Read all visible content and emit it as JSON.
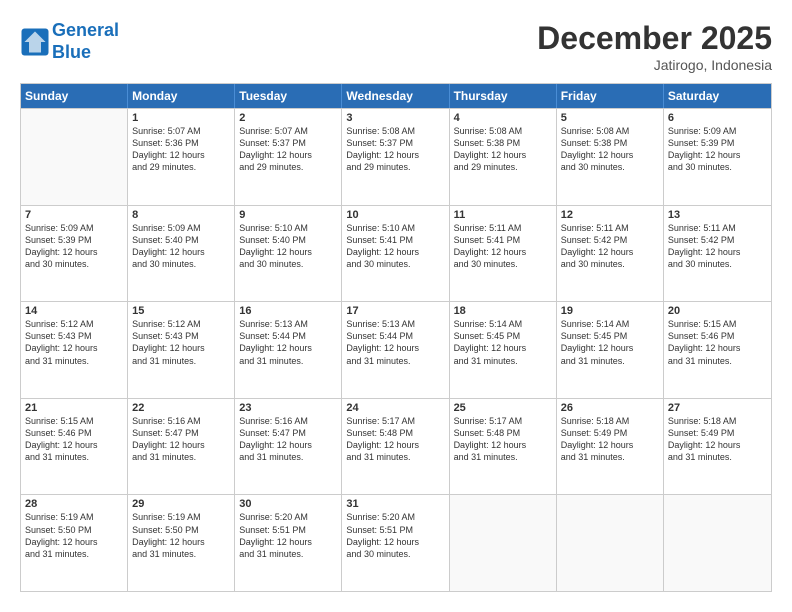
{
  "logo": {
    "line1": "General",
    "line2": "Blue"
  },
  "title": "December 2025",
  "subtitle": "Jatirogo, Indonesia",
  "header_days": [
    "Sunday",
    "Monday",
    "Tuesday",
    "Wednesday",
    "Thursday",
    "Friday",
    "Saturday"
  ],
  "weeks": [
    [
      {
        "day": "",
        "lines": []
      },
      {
        "day": "1",
        "lines": [
          "Sunrise: 5:07 AM",
          "Sunset: 5:36 PM",
          "Daylight: 12 hours",
          "and 29 minutes."
        ]
      },
      {
        "day": "2",
        "lines": [
          "Sunrise: 5:07 AM",
          "Sunset: 5:37 PM",
          "Daylight: 12 hours",
          "and 29 minutes."
        ]
      },
      {
        "day": "3",
        "lines": [
          "Sunrise: 5:08 AM",
          "Sunset: 5:37 PM",
          "Daylight: 12 hours",
          "and 29 minutes."
        ]
      },
      {
        "day": "4",
        "lines": [
          "Sunrise: 5:08 AM",
          "Sunset: 5:38 PM",
          "Daylight: 12 hours",
          "and 29 minutes."
        ]
      },
      {
        "day": "5",
        "lines": [
          "Sunrise: 5:08 AM",
          "Sunset: 5:38 PM",
          "Daylight: 12 hours",
          "and 30 minutes."
        ]
      },
      {
        "day": "6",
        "lines": [
          "Sunrise: 5:09 AM",
          "Sunset: 5:39 PM",
          "Daylight: 12 hours",
          "and 30 minutes."
        ]
      }
    ],
    [
      {
        "day": "7",
        "lines": [
          "Sunrise: 5:09 AM",
          "Sunset: 5:39 PM",
          "Daylight: 12 hours",
          "and 30 minutes."
        ]
      },
      {
        "day": "8",
        "lines": [
          "Sunrise: 5:09 AM",
          "Sunset: 5:40 PM",
          "Daylight: 12 hours",
          "and 30 minutes."
        ]
      },
      {
        "day": "9",
        "lines": [
          "Sunrise: 5:10 AM",
          "Sunset: 5:40 PM",
          "Daylight: 12 hours",
          "and 30 minutes."
        ]
      },
      {
        "day": "10",
        "lines": [
          "Sunrise: 5:10 AM",
          "Sunset: 5:41 PM",
          "Daylight: 12 hours",
          "and 30 minutes."
        ]
      },
      {
        "day": "11",
        "lines": [
          "Sunrise: 5:11 AM",
          "Sunset: 5:41 PM",
          "Daylight: 12 hours",
          "and 30 minutes."
        ]
      },
      {
        "day": "12",
        "lines": [
          "Sunrise: 5:11 AM",
          "Sunset: 5:42 PM",
          "Daylight: 12 hours",
          "and 30 minutes."
        ]
      },
      {
        "day": "13",
        "lines": [
          "Sunrise: 5:11 AM",
          "Sunset: 5:42 PM",
          "Daylight: 12 hours",
          "and 30 minutes."
        ]
      }
    ],
    [
      {
        "day": "14",
        "lines": [
          "Sunrise: 5:12 AM",
          "Sunset: 5:43 PM",
          "Daylight: 12 hours",
          "and 31 minutes."
        ]
      },
      {
        "day": "15",
        "lines": [
          "Sunrise: 5:12 AM",
          "Sunset: 5:43 PM",
          "Daylight: 12 hours",
          "and 31 minutes."
        ]
      },
      {
        "day": "16",
        "lines": [
          "Sunrise: 5:13 AM",
          "Sunset: 5:44 PM",
          "Daylight: 12 hours",
          "and 31 minutes."
        ]
      },
      {
        "day": "17",
        "lines": [
          "Sunrise: 5:13 AM",
          "Sunset: 5:44 PM",
          "Daylight: 12 hours",
          "and 31 minutes."
        ]
      },
      {
        "day": "18",
        "lines": [
          "Sunrise: 5:14 AM",
          "Sunset: 5:45 PM",
          "Daylight: 12 hours",
          "and 31 minutes."
        ]
      },
      {
        "day": "19",
        "lines": [
          "Sunrise: 5:14 AM",
          "Sunset: 5:45 PM",
          "Daylight: 12 hours",
          "and 31 minutes."
        ]
      },
      {
        "day": "20",
        "lines": [
          "Sunrise: 5:15 AM",
          "Sunset: 5:46 PM",
          "Daylight: 12 hours",
          "and 31 minutes."
        ]
      }
    ],
    [
      {
        "day": "21",
        "lines": [
          "Sunrise: 5:15 AM",
          "Sunset: 5:46 PM",
          "Daylight: 12 hours",
          "and 31 minutes."
        ]
      },
      {
        "day": "22",
        "lines": [
          "Sunrise: 5:16 AM",
          "Sunset: 5:47 PM",
          "Daylight: 12 hours",
          "and 31 minutes."
        ]
      },
      {
        "day": "23",
        "lines": [
          "Sunrise: 5:16 AM",
          "Sunset: 5:47 PM",
          "Daylight: 12 hours",
          "and 31 minutes."
        ]
      },
      {
        "day": "24",
        "lines": [
          "Sunrise: 5:17 AM",
          "Sunset: 5:48 PM",
          "Daylight: 12 hours",
          "and 31 minutes."
        ]
      },
      {
        "day": "25",
        "lines": [
          "Sunrise: 5:17 AM",
          "Sunset: 5:48 PM",
          "Daylight: 12 hours",
          "and 31 minutes."
        ]
      },
      {
        "day": "26",
        "lines": [
          "Sunrise: 5:18 AM",
          "Sunset: 5:49 PM",
          "Daylight: 12 hours",
          "and 31 minutes."
        ]
      },
      {
        "day": "27",
        "lines": [
          "Sunrise: 5:18 AM",
          "Sunset: 5:49 PM",
          "Daylight: 12 hours",
          "and 31 minutes."
        ]
      }
    ],
    [
      {
        "day": "28",
        "lines": [
          "Sunrise: 5:19 AM",
          "Sunset: 5:50 PM",
          "Daylight: 12 hours",
          "and 31 minutes."
        ]
      },
      {
        "day": "29",
        "lines": [
          "Sunrise: 5:19 AM",
          "Sunset: 5:50 PM",
          "Daylight: 12 hours",
          "and 31 minutes."
        ]
      },
      {
        "day": "30",
        "lines": [
          "Sunrise: 5:20 AM",
          "Sunset: 5:51 PM",
          "Daylight: 12 hours",
          "and 31 minutes."
        ]
      },
      {
        "day": "31",
        "lines": [
          "Sunrise: 5:20 AM",
          "Sunset: 5:51 PM",
          "Daylight: 12 hours",
          "and 30 minutes."
        ]
      },
      {
        "day": "",
        "lines": []
      },
      {
        "day": "",
        "lines": []
      },
      {
        "day": "",
        "lines": []
      }
    ]
  ]
}
